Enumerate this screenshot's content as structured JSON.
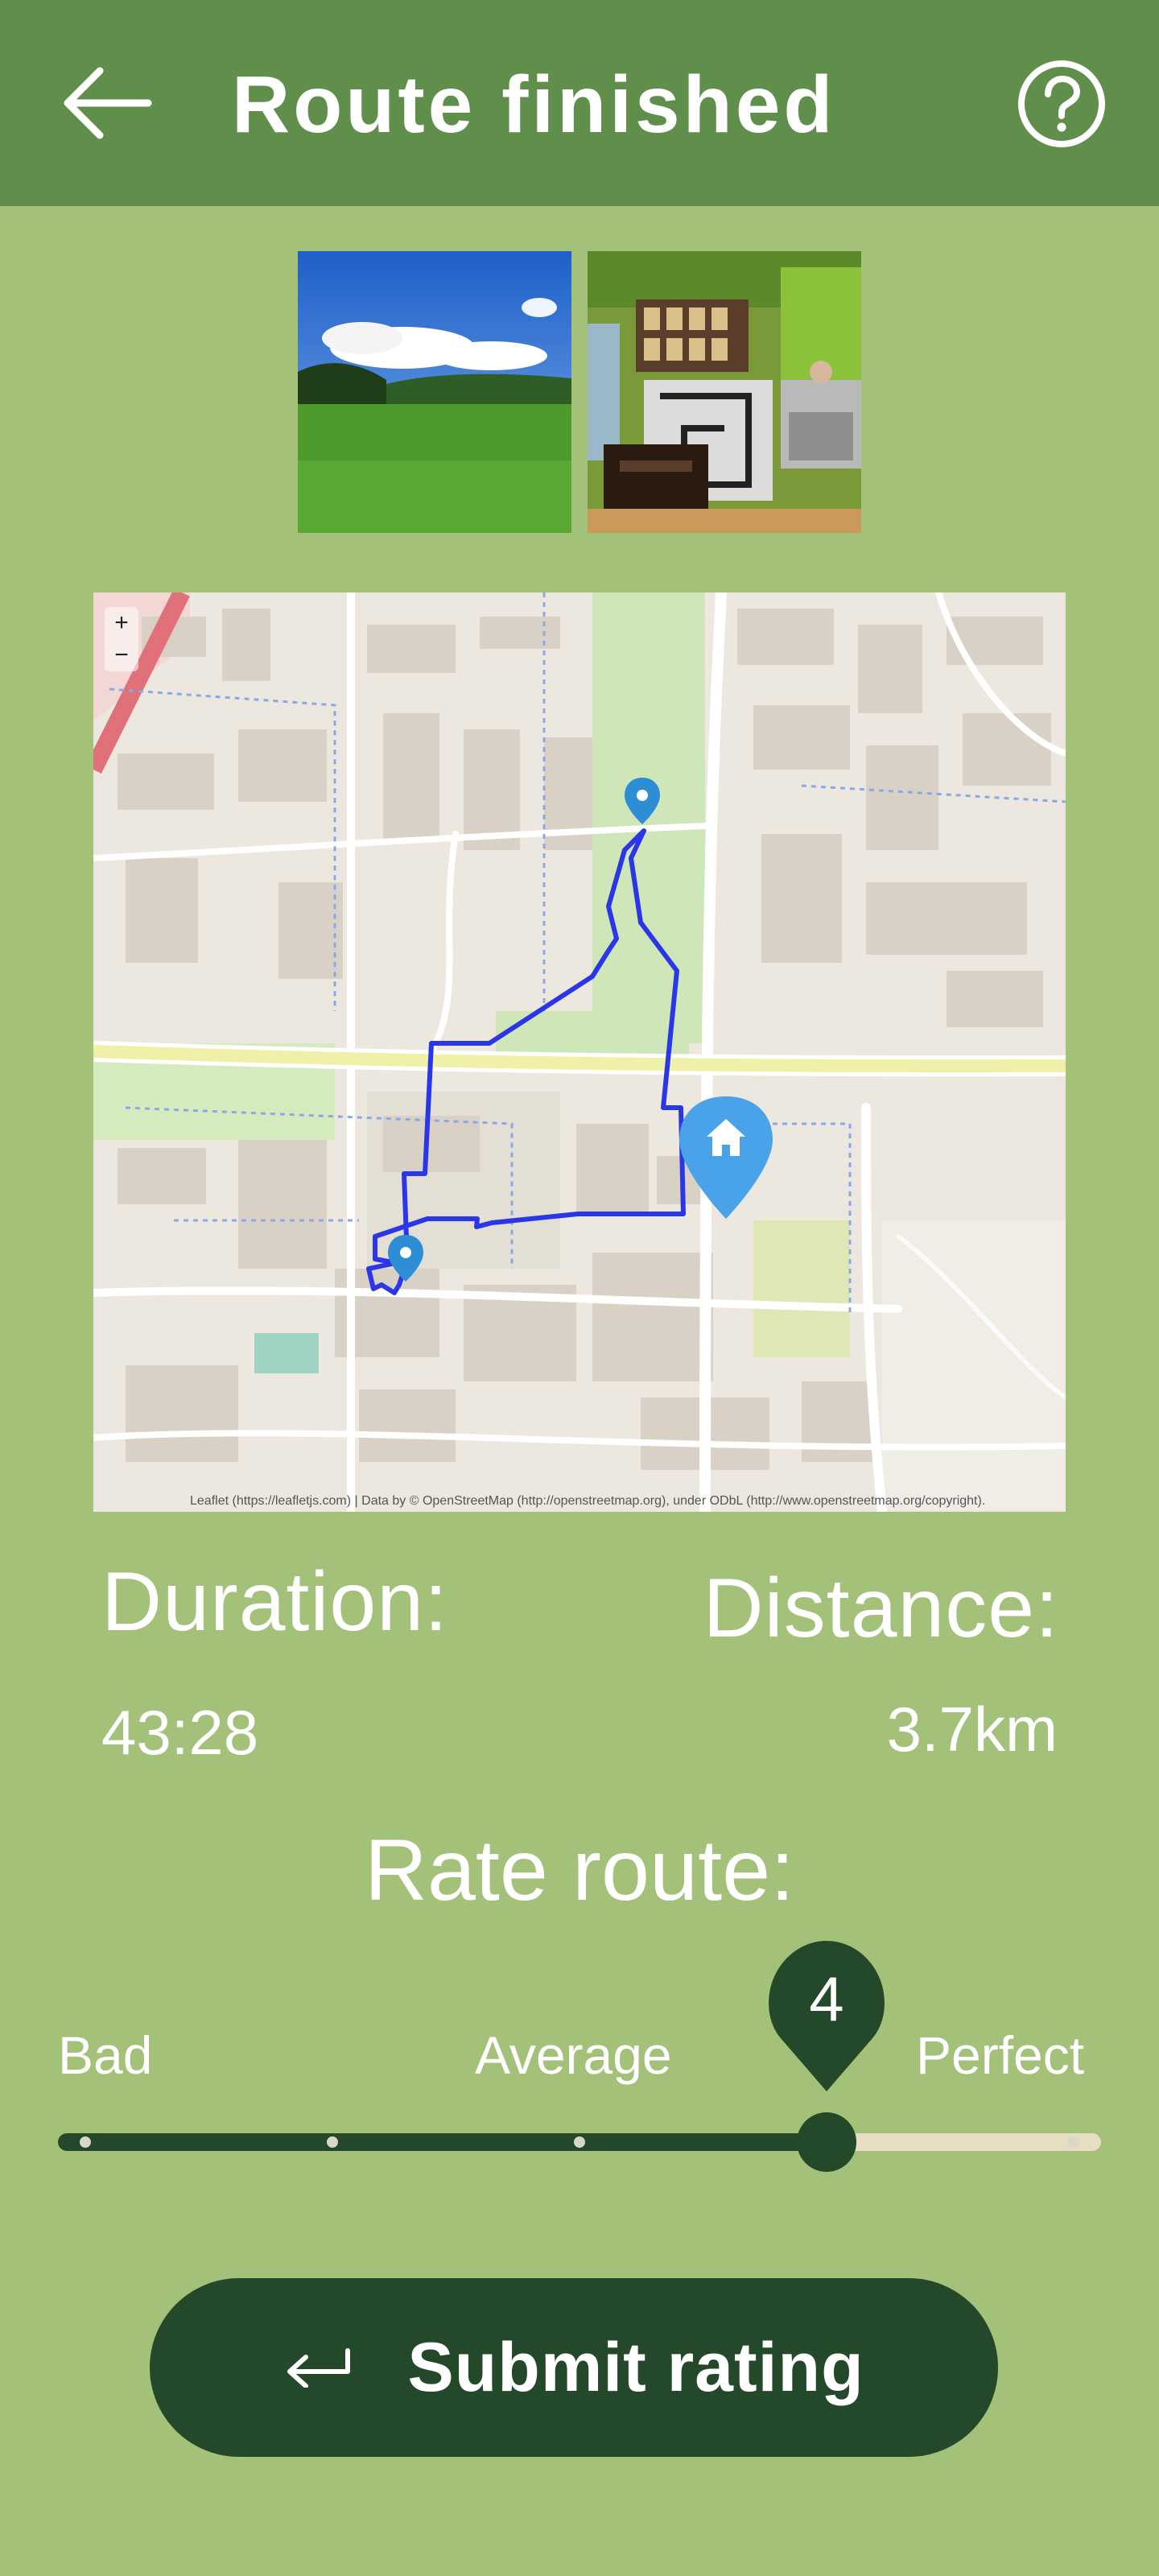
{
  "header": {
    "title": "Route finished",
    "back_icon": "arrow-left-icon",
    "help_icon": "question-circle-icon",
    "color": "#5f8f4b"
  },
  "photos": [
    {
      "name": "green-meadow-photo"
    },
    {
      "name": "cafe-interior-photo"
    }
  ],
  "map": {
    "route_color": "#2a36e8",
    "zoom_in": "+",
    "zoom_out": "−",
    "attribution": "Leaflet (https://leafletjs.com) | Data by © OpenStreetMap (http://openstreetmap.org), under ODbL (http://www.openstreetmap.org/copyright)."
  },
  "stats": {
    "duration_label": "Duration:",
    "duration_value": "43:28",
    "distance_label": "Distance:",
    "distance_value": "3.7km"
  },
  "rating": {
    "title": "Rate route:",
    "labels": {
      "bad": "Bad",
      "average": "Average",
      "perfect": "Perfect"
    },
    "value": 4,
    "min": 1,
    "max": 5,
    "value_text": "4"
  },
  "submit": {
    "label": "Submit rating",
    "icon": "return-arrow-icon"
  },
  "colors": {
    "background": "#a3c178",
    "accent_dark": "#24492a",
    "track_empty": "#e6ddc2"
  }
}
